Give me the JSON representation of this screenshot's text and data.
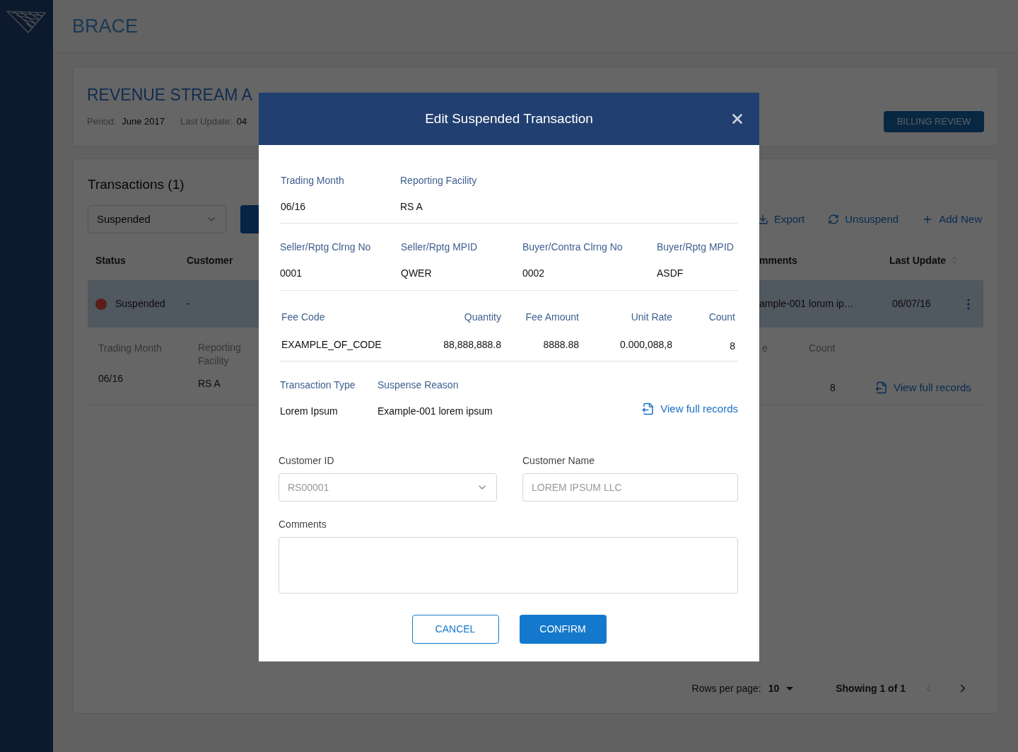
{
  "header": {
    "title": "BRACE"
  },
  "summary": {
    "title": "REVENUE STREAM A",
    "period_label": "Period:",
    "period": "June 2017",
    "last_update_label": "Last Update:",
    "last_update": "04",
    "button": "BILLING REVIEW"
  },
  "transactions": {
    "title": "Transactions (1)",
    "filter": "Suspended",
    "actions": [
      {
        "kind": "export",
        "label": "Export"
      },
      {
        "kind": "unsuspend",
        "label": "Unsuspend"
      },
      {
        "kind": "add",
        "label": "Add New"
      }
    ],
    "columns_left": [
      "Status",
      "Customer"
    ],
    "columns_right": [
      "mments",
      "Last Update"
    ],
    "row": {
      "status": "Suspended",
      "customer": "-",
      "comments": "ample-001 lorum ip…",
      "last_update": "06/07/16",
      "selected": true
    },
    "detail": {
      "labels": [
        "Trading Month",
        "Reporting Facility",
        "e",
        "Count"
      ],
      "values": [
        "06/16",
        "RS A",
        "8"
      ],
      "link": "View full records"
    }
  },
  "pagination": {
    "rows_label": "Rows per page:",
    "rows": "10",
    "showing": "Showing 1 of 1",
    "prev_disabled": true
  },
  "modal": {
    "title": "Edit Suspended Transaction",
    "general": [
      {
        "label": "Trading Month",
        "value": "06/16"
      },
      {
        "label": "Reporting Facility",
        "value": "RS A"
      }
    ],
    "parties": [
      {
        "label": "Seller/Rptg Clrng No",
        "value": "0001"
      },
      {
        "label": "Seller/Rptg MPID",
        "value": "QWER"
      },
      {
        "label": "Buyer/Contra Clrng No",
        "value": "0002"
      },
      {
        "label": "Buyer/Rptg MPID",
        "value": "ASDF"
      }
    ],
    "fees": [
      {
        "label": "Fee Code",
        "value": "EXAMPLE_OF_CODE"
      },
      {
        "label": "Quantity",
        "value": "88,888,888.8"
      },
      {
        "label": "Fee Amount",
        "value": "8888.88"
      },
      {
        "label": "Unit Rate",
        "value": "0.000,088,8"
      },
      {
        "label": "Count",
        "value": "8"
      }
    ],
    "reason": [
      {
        "label": "Transaction Type",
        "value": "Lorem Ipsum"
      },
      {
        "label": "Suspense Reason",
        "value": "Example-001 lorem ipsum"
      }
    ],
    "link": "View full records",
    "customer_id": {
      "label": "Customer ID",
      "placeholder": "RS00001"
    },
    "customer_name": {
      "label": "Customer Name",
      "placeholder": "LOREM IPSUM LLC"
    },
    "comments": {
      "label": "Comments"
    },
    "buttons": [
      {
        "kind": "secondary",
        "label": "CANCEL"
      },
      {
        "kind": "primary",
        "label": "CONFIRM"
      }
    ]
  }
}
